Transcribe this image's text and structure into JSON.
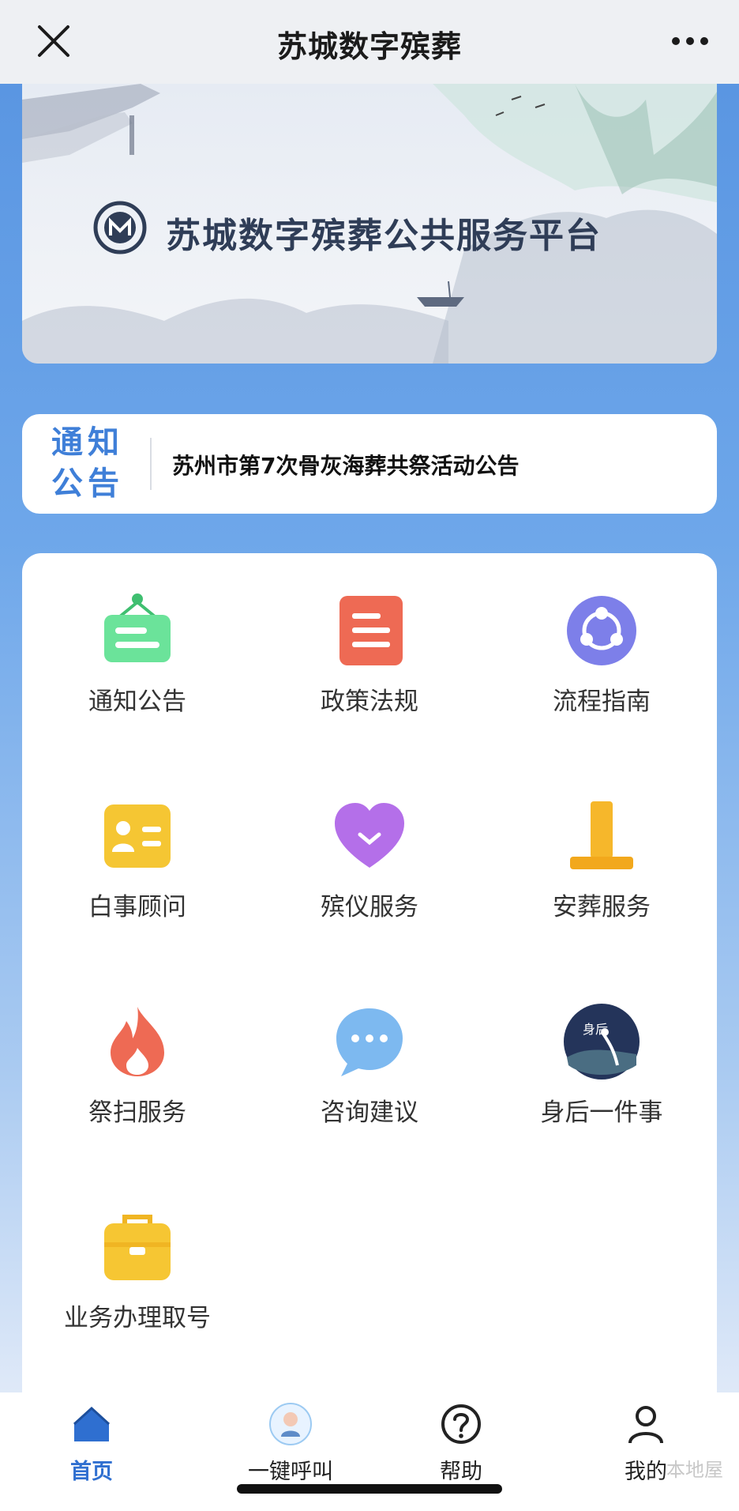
{
  "header": {
    "title": "苏城数字殡葬",
    "close_icon": "close-icon",
    "more_icon": "more-icon"
  },
  "banner": {
    "text": "苏城数字殡葬公共服务平台",
    "logo_icon": "civil-affairs-logo-icon"
  },
  "notice": {
    "tag_line1": "通知",
    "tag_line2": "公告",
    "text": "苏州市第7次骨灰海葬共祭活动公告"
  },
  "grid": {
    "items": [
      {
        "label": "通知公告",
        "icon": "notice-board-icon",
        "color": "#5fd98a"
      },
      {
        "label": "政策法规",
        "icon": "document-icon",
        "color": "#ef6a55"
      },
      {
        "label": "流程指南",
        "icon": "share-flow-icon",
        "color": "#7c7fe8"
      },
      {
        "label": "白事顾问",
        "icon": "contact-card-icon",
        "color": "#f4c330"
      },
      {
        "label": "殡仪服务",
        "icon": "heart-icon",
        "color": "#b06fe8"
      },
      {
        "label": "安葬服务",
        "icon": "tombstone-icon",
        "color": "#f4b32a"
      },
      {
        "label": "祭扫服务",
        "icon": "flame-icon",
        "color": "#ef6a55"
      },
      {
        "label": "咨询建议",
        "icon": "chat-bubble-icon",
        "color": "#6aaef0"
      },
      {
        "label": "身后一件事",
        "icon": "ink-painting-icon",
        "color": "#24345a"
      },
      {
        "label": "业务办理取号",
        "icon": "briefcase-icon",
        "color": "#f4c330"
      }
    ]
  },
  "tabbar": {
    "tabs": [
      {
        "label": "首页",
        "icon": "home-icon",
        "active": true
      },
      {
        "label": "一键呼叫",
        "icon": "avatar-call-icon",
        "active": false
      },
      {
        "label": "帮助",
        "icon": "help-icon",
        "active": false
      },
      {
        "label": "我的",
        "icon": "user-icon",
        "active": false
      }
    ],
    "active_color": "#2f6fd0"
  },
  "watermark": "本地屋"
}
